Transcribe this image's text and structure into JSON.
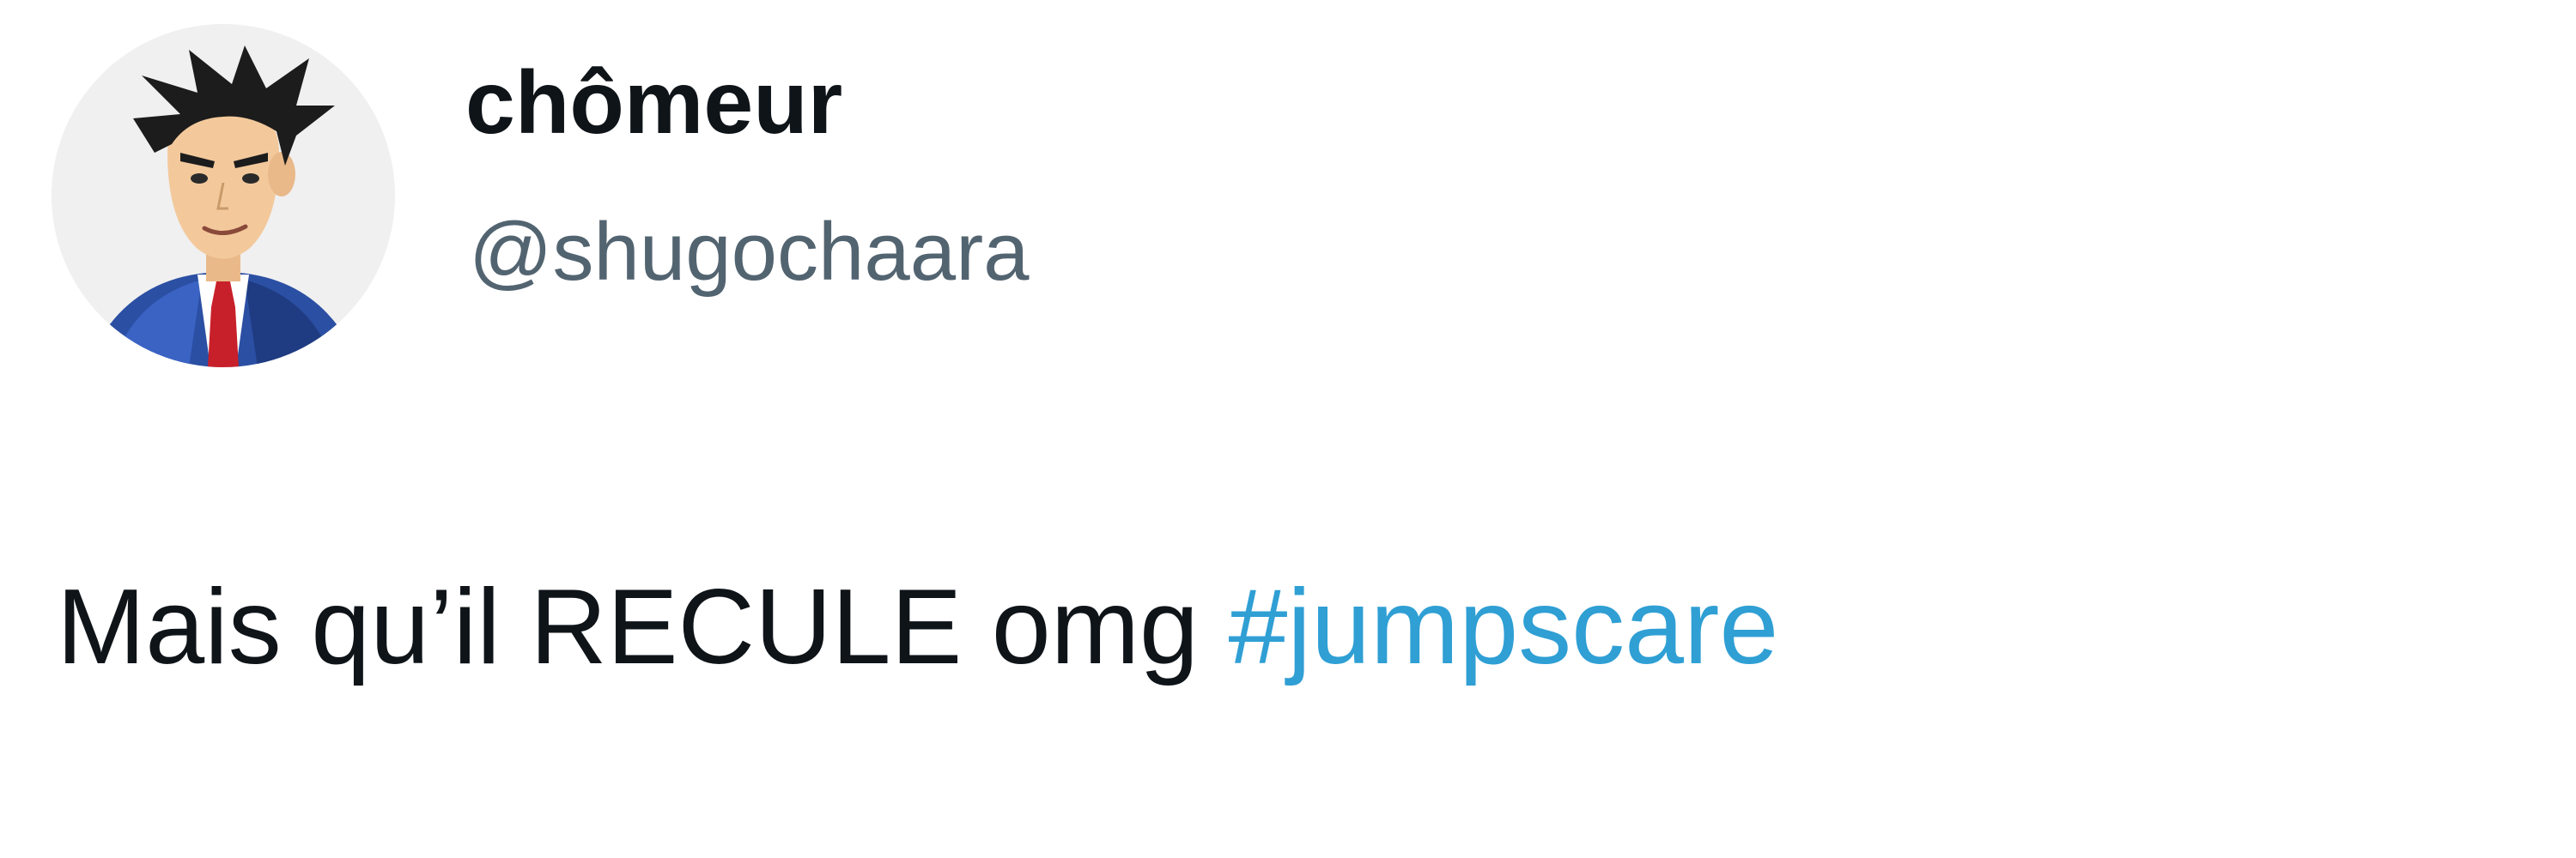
{
  "user": {
    "display_name": "chômeur",
    "handle": "@shugochaara"
  },
  "tweet": {
    "text": "Mais qu’il RECULE omg",
    "hashtag": "#jumpscare"
  },
  "colors": {
    "text": "#0f1419",
    "handle": "#536471",
    "hashtag": "#2f9fd4"
  }
}
